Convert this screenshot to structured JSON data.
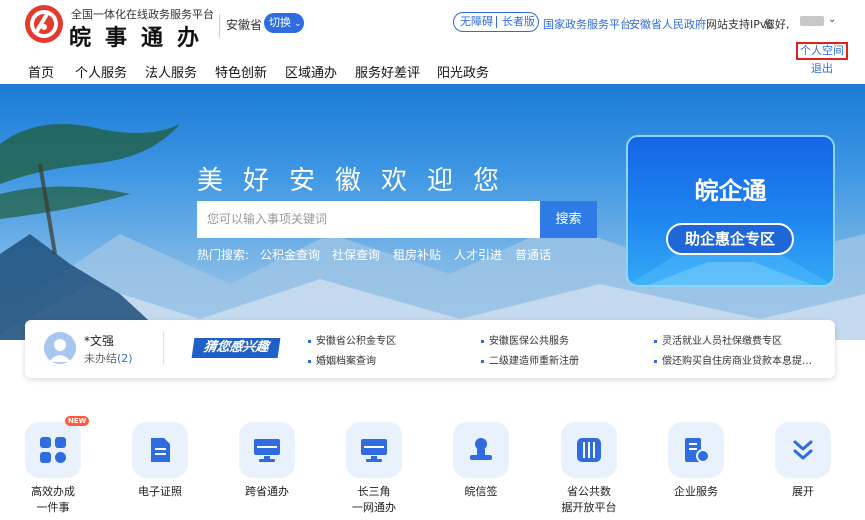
{
  "header": {
    "logo_subtitle": "全国一体化在线政务服务平台",
    "logo_title": "皖事通办",
    "province": "安徽省",
    "switch_label": "切换",
    "accessibility": "无障碍",
    "elder": "长者版",
    "links": [
      "国家政务服务平台",
      "安徽省人民政府"
    ],
    "ipv6": "网站支持IPv6",
    "greeting": "您好,"
  },
  "user_menu": {
    "personal_space": "个人空间",
    "logout": "退出"
  },
  "nav": [
    "首页",
    "个人服务",
    "法人服务",
    "特色创新",
    "区域通办",
    "服务好差评",
    "阳光政务"
  ],
  "hero": {
    "title": "美好安徽欢迎您",
    "search_placeholder": "您可以输入事项关键词",
    "search_button": "搜索",
    "hot_label": "热门搜索:",
    "hot_items": [
      "公积金查询",
      "社保查询",
      "租房补贴",
      "人才引进",
      "普通话"
    ]
  },
  "promo": {
    "title": "皖企通",
    "pill": "助企惠企专区"
  },
  "user_card": {
    "name": "*文强",
    "unfinished_label": "未办结",
    "unfinished_count": "(2)",
    "banner": "猜您感兴趣"
  },
  "suggestions": [
    "安徽省公积金专区",
    "安徽医保公共服务",
    "灵活就业人员社保缴费专区",
    "婚姻档案查询",
    "二级建造师重新注册",
    "偿还购买自住房商业贷款本息提…"
  ],
  "tiles": [
    {
      "label": "高效办成一件事",
      "icon": "grid-apps-icon",
      "badge": "NEW"
    },
    {
      "label": "电子证照",
      "icon": "document-icon"
    },
    {
      "label": "跨省通办",
      "icon": "monitor-icon"
    },
    {
      "label": "长三角一网通办",
      "icon": "monitor-icon"
    },
    {
      "label": "皖信签",
      "icon": "stamp-icon"
    },
    {
      "label": "省公共数据开放平台",
      "icon": "building-icon"
    },
    {
      "label": "企业服务",
      "icon": "enterprise-icon"
    },
    {
      "label": "展开",
      "icon": "double-chevron-down-icon"
    }
  ],
  "colors": {
    "brand_red": "#e33a2d",
    "primary_blue": "#2e6ce0",
    "highlight_red": "#e02020"
  }
}
